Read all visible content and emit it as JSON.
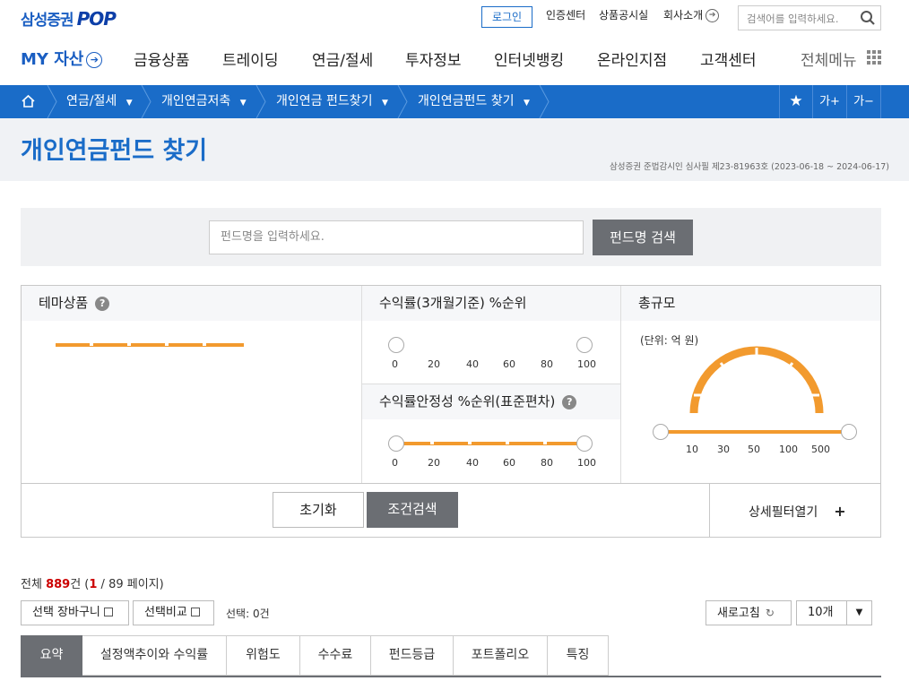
{
  "header": {
    "logo_text": "삼성증권",
    "logo_pop": "POP",
    "login": "로그인",
    "util": [
      "인증센터",
      "상품공시실",
      "회사소개"
    ],
    "search_placeholder": "검색어를 입력하세요.",
    "my_assets": "MY 자산",
    "gnb": [
      "금융상품",
      "트레이딩",
      "연금/절세",
      "투자정보",
      "인터넷뱅킹",
      "온라인지점",
      "고객센터"
    ],
    "all_menu": "전체메뉴"
  },
  "breadcrumb": {
    "items": [
      "연금/절세",
      "개인연금저축",
      "개인연금 펀드찾기",
      "개인연금펀드 찾기"
    ],
    "font_up": "가+",
    "font_down": "가−"
  },
  "page": {
    "title": "개인연금펀드 찾기",
    "notice": "삼성증권 준법감시인 심사필 제23-81963호 (2023-06-18 ~ 2024-06-17)"
  },
  "fund_search": {
    "placeholder": "펀드명을 입력하세요.",
    "button": "펀드명 검색"
  },
  "filters": {
    "theme": "테마상품",
    "return": {
      "label": "수익률(3개월기준) %순위",
      "ticks": [
        "0",
        "20",
        "40",
        "60",
        "80",
        "100"
      ],
      "range": [
        0,
        100
      ]
    },
    "stability": {
      "label": "수익률안정성 %순위(표준편차)",
      "ticks": [
        "0",
        "20",
        "40",
        "60",
        "80",
        "100"
      ],
      "range": [
        0,
        100
      ]
    },
    "size": {
      "label": "총규모",
      "unit": "(단위: 억 원)",
      "ticks": [
        "10",
        "30",
        "50",
        "100",
        "500"
      ]
    },
    "reset": "초기화",
    "apply": "조건검색",
    "detail": "상세필터열기",
    "detail_icon": "+"
  },
  "results": {
    "total_prefix": "전체 ",
    "total": "889",
    "total_suffix": "건 (",
    "page": "1",
    "page_suffix": " / 89 페이지)",
    "cart": "선택 장바구니",
    "compare": "선택비교",
    "selected": "선택: 0건",
    "refresh": "새로고침",
    "page_size": "10개"
  },
  "tabs": [
    "요약",
    "설정액추이와 수익률",
    "위험도",
    "수수료",
    "펀드등급",
    "포트폴리오",
    "특징"
  ],
  "colors": {
    "primary": "#1a6cc8",
    "accent": "#f29a2e",
    "dark_button": "#6b6e73"
  }
}
